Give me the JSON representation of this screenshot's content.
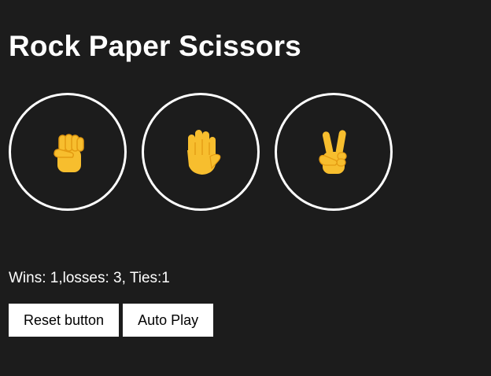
{
  "app": {
    "title": "Rock Paper Scissors"
  },
  "moves": [
    {
      "name": "rock",
      "icon": "raised-fist-icon"
    },
    {
      "name": "paper",
      "icon": "raised-hand-icon"
    },
    {
      "name": "scissors",
      "icon": "victory-hand-icon"
    }
  ],
  "score": {
    "text": "Wins: 1,losses: 3, Ties:1"
  },
  "actions": {
    "reset_label": "Reset button",
    "autoplay_label": "Auto Play"
  },
  "colors": {
    "background": "#1c1c1c",
    "emoji_yellow": "#f7be2e",
    "emoji_shade": "#e49b12"
  }
}
